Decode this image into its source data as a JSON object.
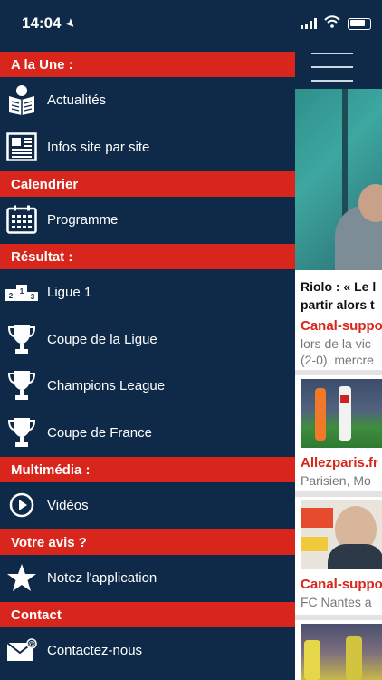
{
  "status": {
    "time": "14:04"
  },
  "menu": {
    "sections": [
      {
        "title": "A la Une :"
      },
      {
        "title": "Calendrier"
      },
      {
        "title": "Résultat :"
      },
      {
        "title": "Multimédia :"
      },
      {
        "title": "Votre avis ?"
      },
      {
        "title": "Contact"
      }
    ],
    "items": [
      {
        "label": "Actualités",
        "icon": "newspaper-reader-icon"
      },
      {
        "label": "Infos site par site",
        "icon": "newspaper-icon"
      },
      {
        "label": "Programme",
        "icon": "calendar-icon"
      },
      {
        "label": "Ligue 1",
        "icon": "podium-icon"
      },
      {
        "label": "Coupe de la Ligue",
        "icon": "trophy-icon"
      },
      {
        "label": "Champions League",
        "icon": "trophy-icon"
      },
      {
        "label": "Coupe de France",
        "icon": "trophy-icon"
      },
      {
        "label": "Vidéos",
        "icon": "play-icon"
      },
      {
        "label": "Notez l'application",
        "icon": "star-icon"
      },
      {
        "label": "Contactez-nous",
        "icon": "mail-icon"
      }
    ]
  },
  "content": {
    "headline_line1": "Riolo : « Le l",
    "headline_line2": "partir alors t",
    "articles": [
      {
        "source": "Canal-suppo",
        "snippet1": "lors de la vic",
        "snippet2": "(2-0), mercre"
      },
      {
        "source": "Allezparis.fr",
        "snippet1": "Parisien, Mo"
      },
      {
        "source": "Canal-suppo",
        "snippet1": "FC Nantes a"
      }
    ]
  },
  "colors": {
    "accent": "#d8261c",
    "navy": "#0f2a48"
  }
}
